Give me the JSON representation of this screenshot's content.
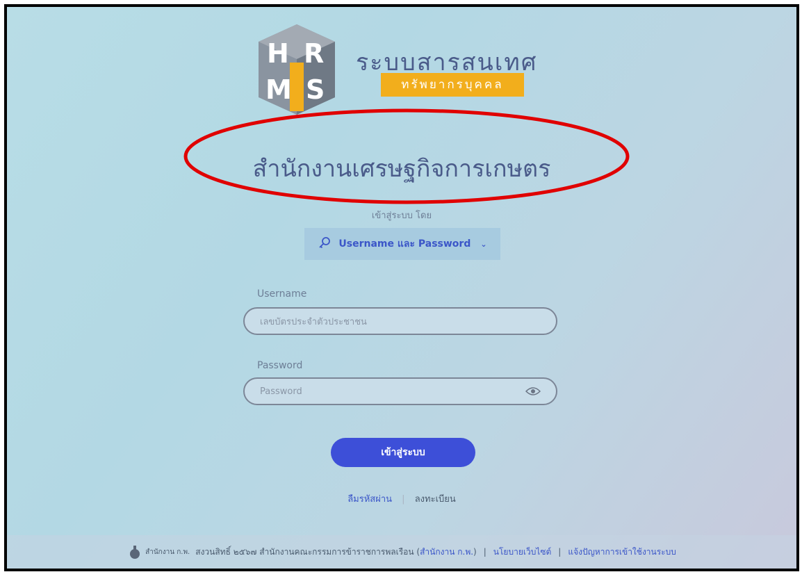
{
  "header": {
    "logo_letters": [
      "H",
      "R",
      "M",
      "S"
    ],
    "system_title": "ระบบสารสนเทศ",
    "system_subtitle": "ทรัพยากรบุคคล",
    "organization": "สำนักงานเศรษฐกิจการเกษตร"
  },
  "login": {
    "login_by_label": "เข้าสู่ระบบ โดย",
    "method": "Username และ Password",
    "username_label": "Username",
    "username_placeholder": "เลขบัตรประจำตัวประชาชน",
    "password_label": "Password",
    "password_placeholder": "Password",
    "submit_label": "เข้าสู่ระบบ",
    "forgot_label": "ลืมรหัสผ่าน",
    "separator": "|",
    "register_label": "ลงทะเบียน"
  },
  "footer": {
    "logo_text": "สำนักงาน ก.พ.",
    "copyright": "สงวนสิทธิ์ ๒๕๖๗ สำนักงานคณะกรรมการข้าราชการพลเรือน (",
    "ocsc_link": "สำนักงาน ก.พ.",
    "close_paren": ")",
    "sep": "|",
    "policy_link": "นโยบายเว็บไซต์",
    "report_link": "แจ้งปัญหาการเข้าใช้งานระบบ"
  },
  "colors": {
    "accent": "#3d4fd8",
    "title": "#4a5b8a",
    "brand_orange": "#f2ae1c",
    "annotation_red": "#e00000"
  },
  "icons": {
    "method": "key-icon",
    "dropdown": "chevron-down-icon",
    "password_toggle": "eye-icon"
  }
}
